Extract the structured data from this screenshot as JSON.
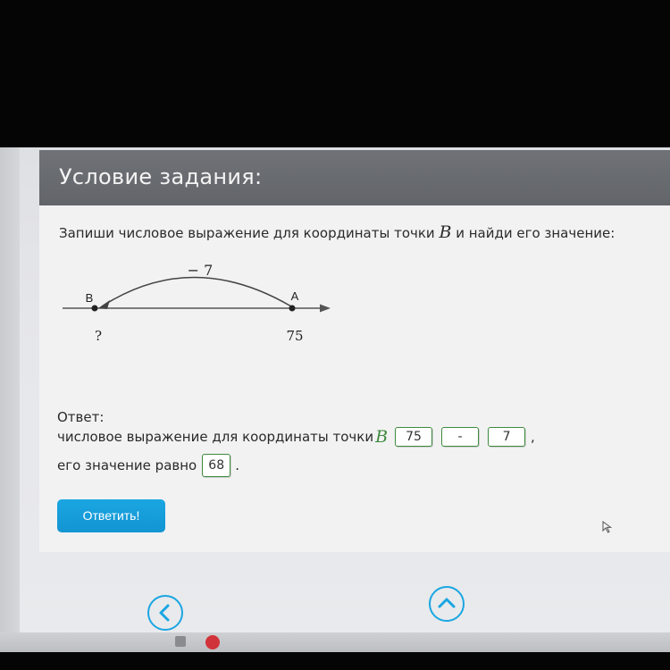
{
  "task": {
    "title": "Условие задания:",
    "instruction_before": "Запиши числовое выражение для координаты точки ",
    "instruction_var": "B",
    "instruction_after": " и найди его значение:"
  },
  "number_line": {
    "arc_label": "− 7",
    "point_b_label": "B",
    "point_a_label": "A",
    "point_b_value": "?",
    "point_a_value": "75"
  },
  "answer": {
    "label": "Ответ:",
    "expression_prefix": "числовое выражение для координаты точки ",
    "expression_var": "B",
    "box1": "75",
    "box2": "-",
    "box3": "7",
    "expression_suffix": ",",
    "value_prefix": "его значение равно ",
    "value_box": "68",
    "value_suffix": "."
  },
  "submit_label": "Ответить!",
  "nav": {
    "back_icon": "chevron-left-icon",
    "up_icon": "chevron-up-icon"
  },
  "colors": {
    "header_bg": "#66696e",
    "accent_blue": "#1aa6e2",
    "input_border_green": "#3d8a3d"
  }
}
